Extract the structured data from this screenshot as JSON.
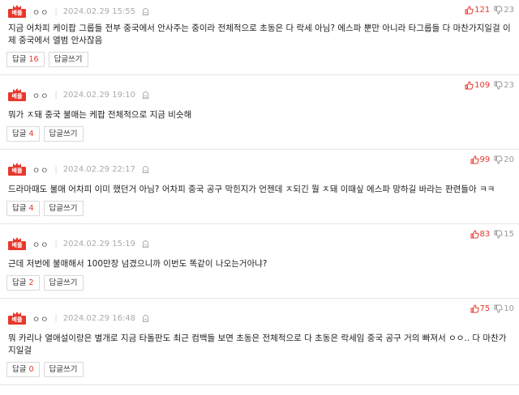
{
  "badge_label": "베플",
  "reply_label": "답글",
  "write_label": "답글쓰기",
  "comments": [
    {
      "nick": "ㅇㅇ",
      "date": "2024.02.29 15:55",
      "up": "121",
      "down": "23",
      "text": "지금 어차피 케이팝 그룹들 전부 중국에서 안사주는 중이라 전체적으로 초동은 다 락세 아님? 에스파 뿐만 아니라 타그룹들 다 마찬가지일걸 이제 중국에서 앨범 안사잖음",
      "replies": "16"
    },
    {
      "nick": "ㅇㅇ",
      "date": "2024.02.29 19:10",
      "up": "109",
      "down": "23",
      "text": "뭐가 ㅈ돼 중국 불매는 케팝 전체적으로 지금 비슷해",
      "replies": "4"
    },
    {
      "nick": "ㅇㅇ",
      "date": "2024.02.29 22:17",
      "up": "99",
      "down": "20",
      "text": "드라마때도 불매 어차피 이미 했던거 아님? 어차피 중국 공구 막힌지가 언젠데 ㅈ되긴 뭘 ㅈ돼 이때싶 에스파 망하길 바라는 판련들아 ㅋㅋ",
      "replies": "4"
    },
    {
      "nick": "ㅇㅇ",
      "date": "2024.02.29 15:19",
      "up": "83",
      "down": "15",
      "text": "근데 저번에 불매해서 100만장 넘겼으니까 이번도 똑같이 나오는거아냐?",
      "replies": "2"
    },
    {
      "nick": "ㅇㅇ",
      "date": "2024.02.29 16:48",
      "up": "75",
      "down": "10",
      "text": "뭐 카리나 열애설이랑은 별개로 지금 타돌판도 최근 컴백들 보면 초동은 전체적으로 다 초동은 락세임 중국 공구 거의 빠져서 ㅇㅇ.. 다 마찬가지일걸",
      "replies": "0"
    }
  ],
  "colors": {
    "accent": "#e8372c",
    "muted": "#999999",
    "border": "#e6e6e6"
  }
}
